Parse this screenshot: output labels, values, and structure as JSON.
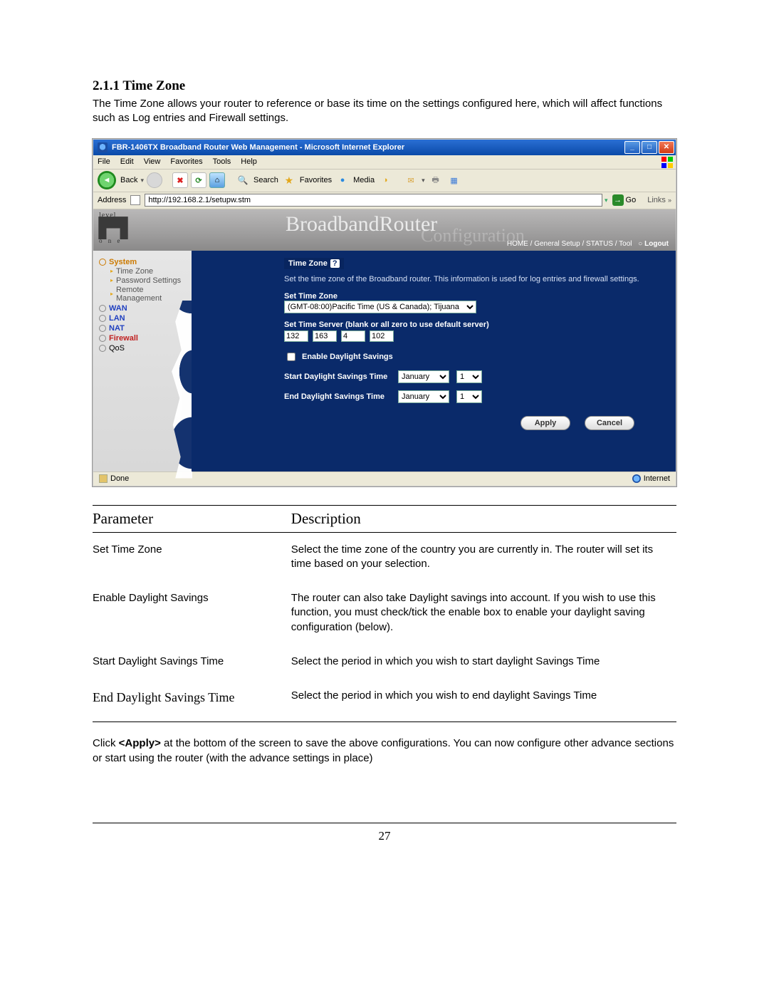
{
  "doc": {
    "section_heading": "2.1.1 Time Zone",
    "intro": "The Time Zone allows your router to reference or base its time on the settings configured here, which will affect functions such as Log entries and Firewall settings.",
    "closing_prefix": "Click ",
    "closing_apply": "<Apply>",
    "closing_suffix": " at the bottom of the screen to save the above configurations. You can now configure other advance sections or start using the router (with the advance settings in place)",
    "page_number": "27"
  },
  "ie": {
    "title": "FBR-1406TX Broadband Router Web Management - Microsoft Internet Explorer",
    "menus": [
      "File",
      "Edit",
      "View",
      "Favorites",
      "Tools",
      "Help"
    ],
    "toolbar": {
      "back": "Back",
      "search": "Search",
      "favorites": "Favorites",
      "media": "Media"
    },
    "addressbar": {
      "label": "Address",
      "url": "http://192.168.2.1/setupw.stm",
      "go": "Go",
      "links": "Links"
    },
    "status": {
      "left": "Done",
      "right": "Internet"
    }
  },
  "router": {
    "logo": {
      "line1": "level",
      "line2": "o n e",
      "glyph": "▛▜"
    },
    "brand": "BroadbandRouter",
    "conf": "Configuration",
    "crumbs": {
      "home": "HOME",
      "general": "General Setup",
      "status": "STATUS",
      "tool": "Tool",
      "logout": "Logout"
    },
    "sidebar": {
      "system": "System",
      "subs": [
        "Time Zone",
        "Password Settings",
        "Remote Management"
      ],
      "items": [
        "WAN",
        "LAN",
        "NAT",
        "Firewall",
        "QoS"
      ]
    },
    "panel": {
      "title": "Time Zone",
      "desc": "Set the time zone of the Broadband router. This information is used for log entries and firewall settings.",
      "set_tz_label": "Set Time Zone",
      "tz_value": "(GMT-08:00)Pacific Time (US & Canada); Tijuana",
      "nts_label": "Set Time Server (blank or all zero to use default server)",
      "nts_ip": [
        "132",
        "163",
        "4",
        "102"
      ],
      "enable_dst": "Enable Daylight Savings",
      "start_dst": "Start Daylight Savings Time",
      "end_dst": "End Daylight Savings Time",
      "month": "January",
      "day": "1",
      "apply": "Apply",
      "cancel": "Cancel"
    }
  },
  "table": {
    "head_param": "Parameter",
    "head_desc": "Description",
    "rows": [
      {
        "p": "Set Time Zone",
        "d": "Select the time zone of the country you are currently in. The router will set its time based on your selection."
      },
      {
        "p": "Enable Daylight Savings",
        "d": "The router can also take Daylight savings into account. If you wish to use this function, you must check/tick the enable box to enable your daylight saving configuration (below)."
      },
      {
        "p": "Start Daylight Savings Time",
        "d": "Select the period in which you wish to start daylight Savings Time"
      },
      {
        "p": "End Daylight Savings Time",
        "d": "Select the period in which you wish to end daylight Savings Time"
      }
    ]
  }
}
